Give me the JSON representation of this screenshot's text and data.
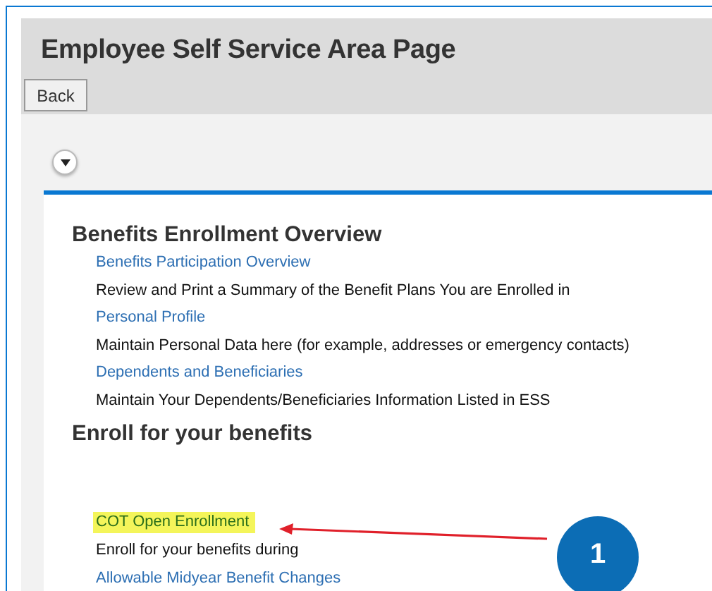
{
  "header": {
    "title": "Employee Self Service Area Page",
    "back_button": "Back"
  },
  "sections": [
    {
      "heading": "Benefits Enrollment Overview",
      "items": [
        {
          "kind": "link",
          "text": "Benefits Participation Overview",
          "highlighted": false
        },
        {
          "kind": "description",
          "text": "Review and Print a Summary of the Benefit Plans You are Enrolled in"
        },
        {
          "kind": "link",
          "text": "Personal Profile",
          "highlighted": false
        },
        {
          "kind": "description",
          "text": "Maintain Personal Data here (for example, addresses or emergency contacts)"
        },
        {
          "kind": "link",
          "text": "Dependents and Beneficiaries",
          "highlighted": false
        },
        {
          "kind": "description",
          "text": "Maintain Your Dependents/Beneficiaries Information Listed in ESS"
        }
      ]
    },
    {
      "heading": "Enroll for your benefits",
      "items": [
        {
          "kind": "link",
          "text": "COT Open Enrollment",
          "highlighted": true
        },
        {
          "kind": "description",
          "text": "Enroll for your benefits during"
        },
        {
          "kind": "link",
          "text": "Allowable Midyear Benefit Changes",
          "highlighted": false
        }
      ]
    }
  ],
  "callout": {
    "number": "1"
  }
}
